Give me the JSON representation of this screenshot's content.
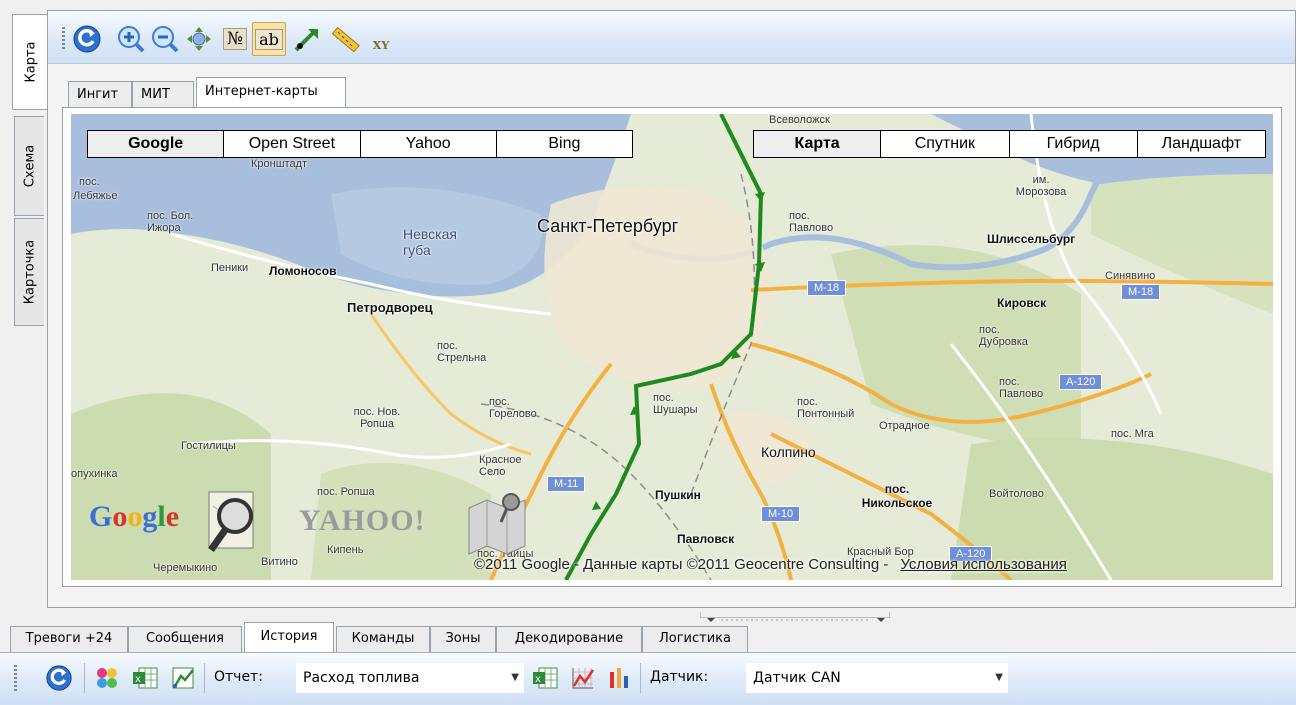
{
  "side_tabs": {
    "map": "Карта",
    "scheme": "Схема",
    "card": "Карточка"
  },
  "inner_tabs": {
    "ingit": "Ингит",
    "mit": "МИТ",
    "internet": "Интернет-карты"
  },
  "providers": {
    "google": "Google",
    "osm": "Open Street",
    "yahoo": "Yahoo",
    "bing": "Bing"
  },
  "map_types": {
    "map": "Карта",
    "satellite": "Спутник",
    "hybrid": "Гибрид",
    "landscape": "Ландшафт"
  },
  "map_labels": {
    "vsevolozhsk": "Всеволожск",
    "spb": "Санкт-Петербург",
    "pos1": "пос.",
    "lebyazhye": "Лебяжье",
    "bol_izhora": "пос. Бол. Ижора",
    "nevskaya": "Невская губа",
    "peniki": "Пеники",
    "lomonosov": "Ломоносов",
    "petrodvorets": "Петродворец",
    "strelna": "пос. Стрельна",
    "pavlovo": "пос. Павлово",
    "im_morozova": "им. Морозова",
    "shlisselburg": "Шлиссельбург",
    "sinyavino": "Синявино",
    "kirovsk": "Кировск",
    "dubrovka": "пос. Дубровка",
    "pavlovo2": "пос. Павлово",
    "mga": "пос. Мга",
    "otradnoe": "Отрадное",
    "pontonny": "пос. Понтонный",
    "kolpino": "Колпино",
    "shushary": "пос. Шушары",
    "gorelovo": "пос. Горелово",
    "nov_ropsha": "пос. Нов. Ропша",
    "gostilitsy": "Гостилицы",
    "krasnoe_selo": "Красное Село",
    "pushkin": "Пушкин",
    "nikolskoe": "пос. Никольское",
    "voytolovo": "Войтолово",
    "ropsha": "пос. Ропша",
    "pavlovsk": "Павловск",
    "kipen": "Кипень",
    "vitino": "Витино",
    "cheremykino": "Черемыкино",
    "taitsy": "пос. Тайцы",
    "krasny_bor": "Красный Бор",
    "lopukhinka": "опухинка",
    "kronshtadt": "Кронштадт",
    "m18a": "M-18",
    "m18b": "M-18",
    "a120a": "A-120",
    "a120b": "A-120",
    "m11": "M-11",
    "m10": "M-10"
  },
  "logos": {
    "google": "Google",
    "yahoo": "YAHOO!"
  },
  "copyright": "©2011 Google - Данные карты ©2011 Geocentre Consulting -",
  "terms_link": "Условия использования",
  "bottom_tabs": {
    "alarms": "Тревоги +24",
    "messages": "Сообщения",
    "history": "История",
    "commands": "Команды",
    "zones": "Зоны",
    "decoding": "Декодирование",
    "logistics": "Логистика"
  },
  "report": {
    "label": "Отчет:",
    "value": "Расход топлива"
  },
  "sensor": {
    "label": "Датчик:",
    "value": "Датчик CAN"
  },
  "toolbar_numbers": "№",
  "toolbar_ab": "ab",
  "toolbar_xy": "XY",
  "colors": {
    "toolbar_top": "#f7fbff",
    "toolbar_bottom": "#cfe0f4",
    "route": "#1e8a1e",
    "road": "#f5b042"
  }
}
